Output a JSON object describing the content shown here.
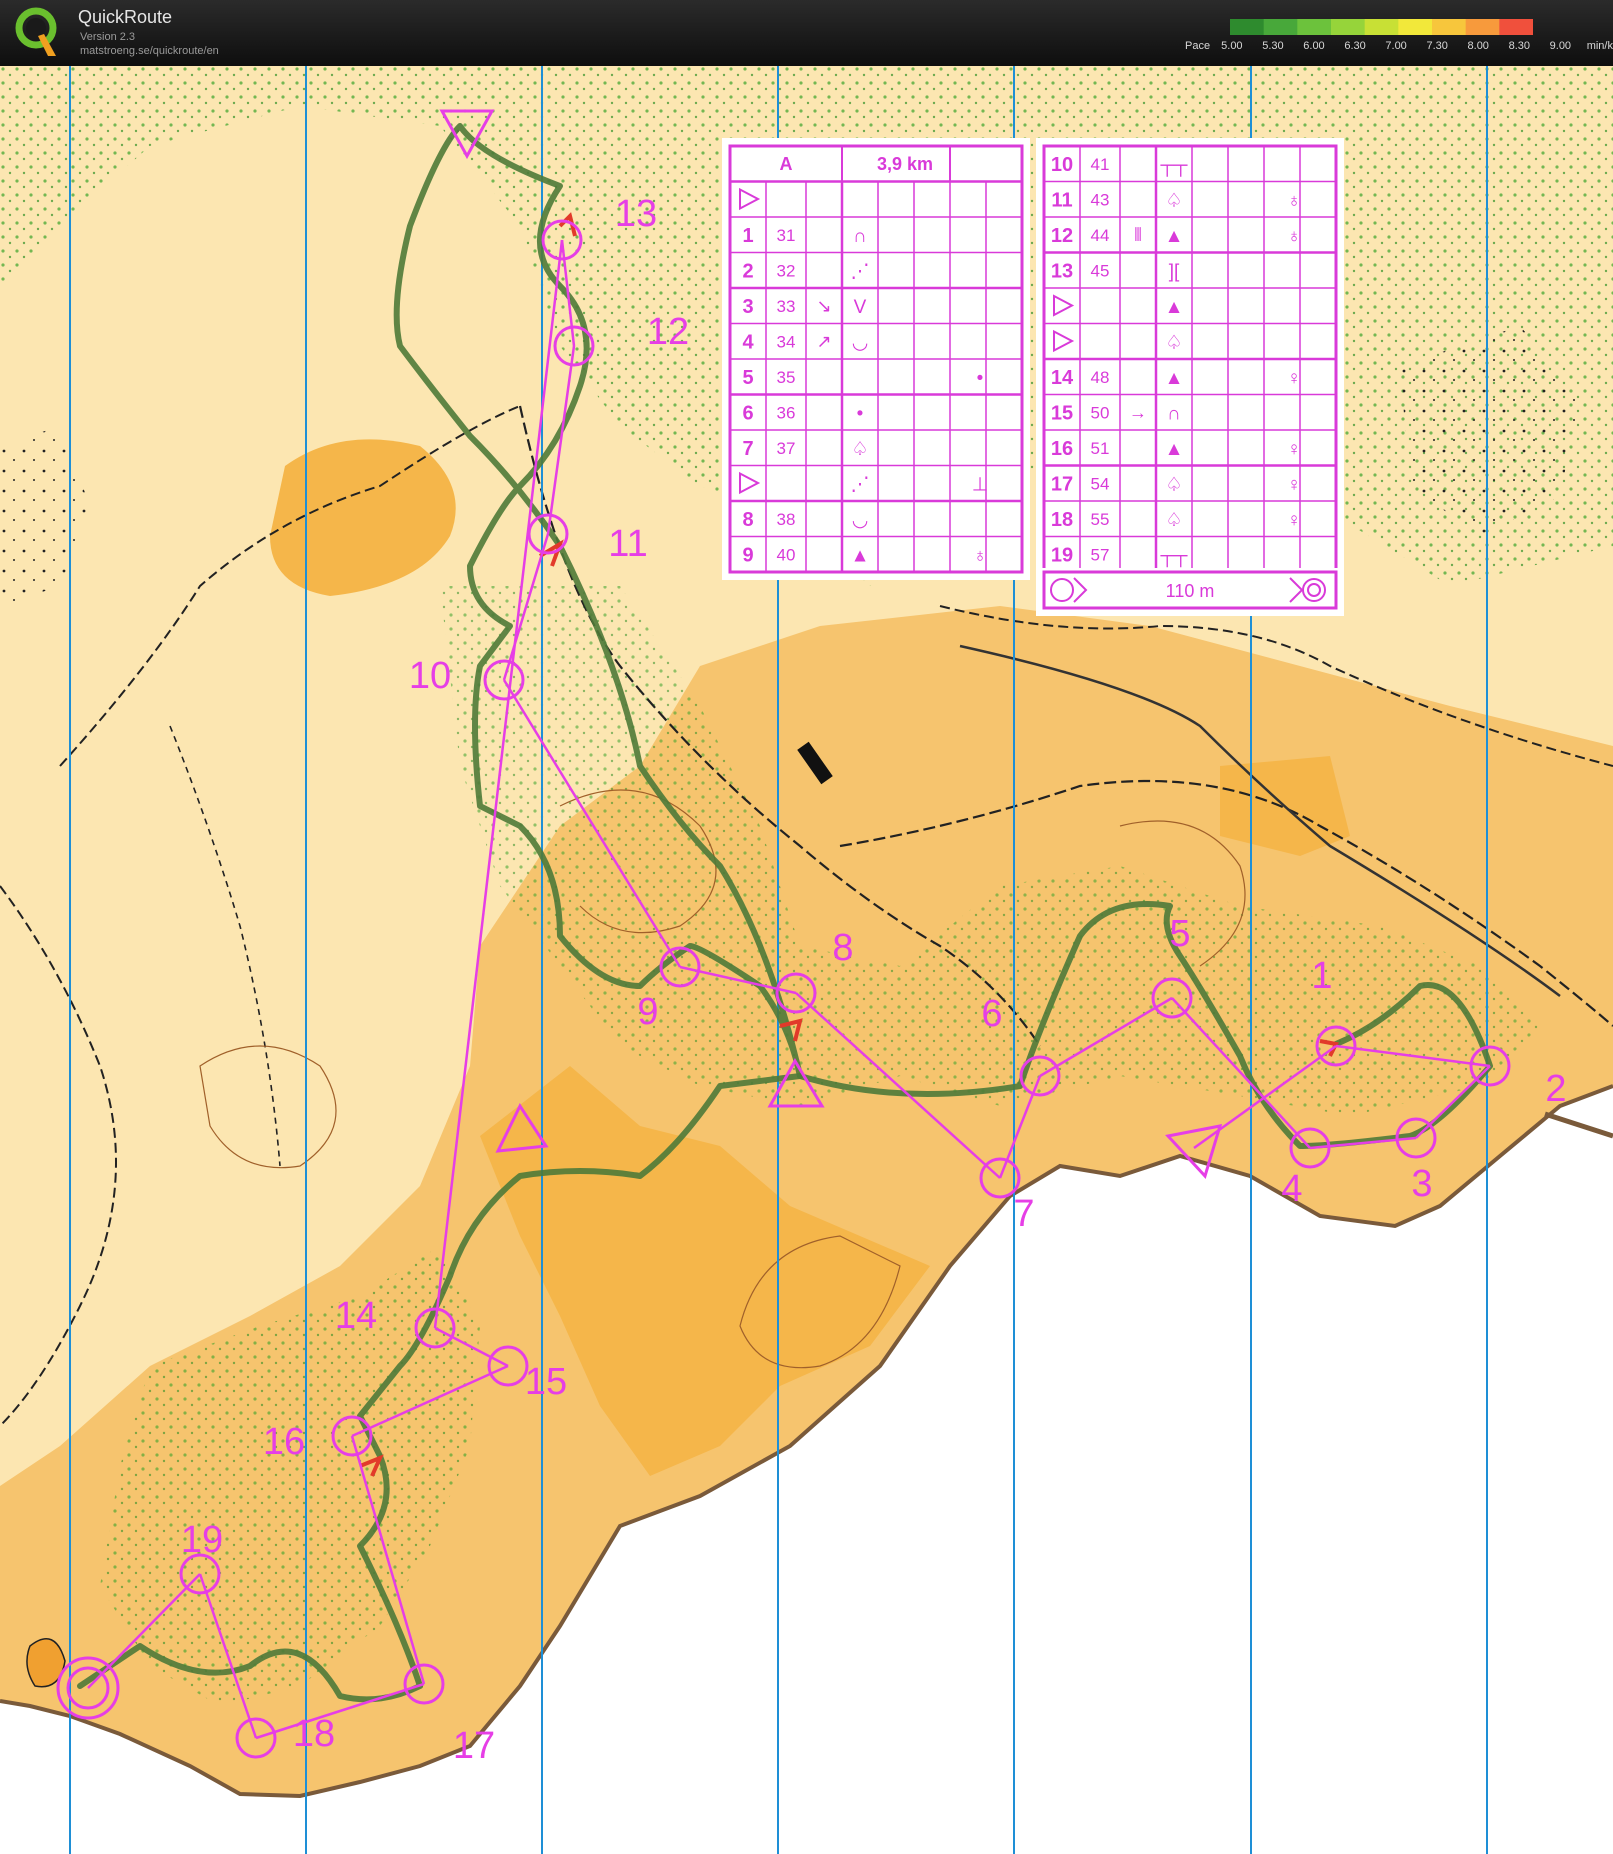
{
  "app": {
    "name": "QuickRoute",
    "version": "Version 2.3",
    "url": "matstroeng.se/quickroute/en"
  },
  "pace_legend": {
    "label": "Pace",
    "values": [
      "5.00",
      "5.30",
      "6.00",
      "6.30",
      "7.00",
      "7.30",
      "8.00",
      "8.30",
      "9.00"
    ],
    "unit": "min/km",
    "colors": [
      "#2e8b2e",
      "#48a83a",
      "#6cc23c",
      "#96d43a",
      "#c8e035",
      "#f2e83a",
      "#f7c63c",
      "#f79a3c",
      "#f0503c"
    ]
  },
  "colors": {
    "course": "#e63ee6",
    "route": "#4f7a38",
    "map_open": "#f6c46e",
    "map_forest": "#fdf7dc",
    "map_green": "#5ed23c",
    "water": "#ffffff",
    "north_lines": "#1e8fd6"
  },
  "controls": [
    {
      "label": "1"
    },
    {
      "label": "2"
    },
    {
      "label": "3"
    },
    {
      "label": "4"
    },
    {
      "label": "5"
    },
    {
      "label": "6"
    },
    {
      "label": "7"
    },
    {
      "label": "8"
    },
    {
      "label": "9"
    },
    {
      "label": "10"
    },
    {
      "label": "11"
    },
    {
      "label": "12"
    },
    {
      "label": "13"
    },
    {
      "label": "14"
    },
    {
      "label": "15"
    },
    {
      "label": "16"
    },
    {
      "label": "17"
    },
    {
      "label": "18"
    },
    {
      "label": "19"
    }
  ],
  "description_sheet": {
    "course": "A",
    "length": "3,9 km",
    "left_rows": [
      {
        "num": "",
        "code": "",
        "dir": "",
        "feature": "",
        "extra": "",
        "is_start": true
      },
      {
        "num": "1",
        "code": "31",
        "dir": "",
        "feature": "∩",
        "extra": ""
      },
      {
        "num": "2",
        "code": "32",
        "dir": "",
        "feature": "⋰",
        "extra": ""
      },
      {
        "num": "3",
        "code": "33",
        "dir": "↘",
        "feature": "V",
        "extra": ""
      },
      {
        "num": "4",
        "code": "34",
        "dir": "↗",
        "feature": "◡",
        "extra": ""
      },
      {
        "num": "5",
        "code": "35",
        "dir": "",
        "feature": "",
        "extra": "•"
      },
      {
        "num": "6",
        "code": "36",
        "dir": "",
        "feature": "•",
        "extra": ""
      },
      {
        "num": "7",
        "code": "37",
        "dir": "",
        "feature": "♤",
        "extra": ""
      },
      {
        "num": "",
        "code": "",
        "dir": "",
        "feature": "⋰",
        "extra": "⊥",
        "is_start": true
      },
      {
        "num": "8",
        "code": "38",
        "dir": "",
        "feature": "◡",
        "extra": ""
      },
      {
        "num": "9",
        "code": "40",
        "dir": "",
        "feature": "▲",
        "extra": "♁"
      }
    ],
    "right_rows": [
      {
        "num": "10",
        "code": "41",
        "dir": "",
        "feature": "┬┬",
        "extra": ""
      },
      {
        "num": "11",
        "code": "43",
        "dir": "",
        "feature": "♤",
        "extra": "♁"
      },
      {
        "num": "12",
        "code": "44",
        "dir": "⫴",
        "feature": "▲",
        "extra": "♁"
      },
      {
        "num": "13",
        "code": "45",
        "dir": "",
        "feature": "][",
        "extra": ""
      },
      {
        "num": "",
        "code": "",
        "dir": "",
        "feature": "▲",
        "extra": "",
        "is_start": true
      },
      {
        "num": "",
        "code": "",
        "dir": "",
        "feature": "♤",
        "extra": "",
        "is_start": true
      },
      {
        "num": "14",
        "code": "48",
        "dir": "",
        "feature": "▲",
        "extra": "♀"
      },
      {
        "num": "15",
        "code": "50",
        "dir": "→",
        "feature": "∩",
        "extra": ""
      },
      {
        "num": "16",
        "code": "51",
        "dir": "",
        "feature": "▲",
        "extra": "♀"
      },
      {
        "num": "17",
        "code": "54",
        "dir": "",
        "feature": "♤",
        "extra": "♀"
      },
      {
        "num": "18",
        "code": "55",
        "dir": "",
        "feature": "♤",
        "extra": "♀"
      },
      {
        "num": "19",
        "code": "57",
        "dir": "",
        "feature": "┬┬",
        "extra": ""
      }
    ],
    "finish_distance": "110 m"
  }
}
